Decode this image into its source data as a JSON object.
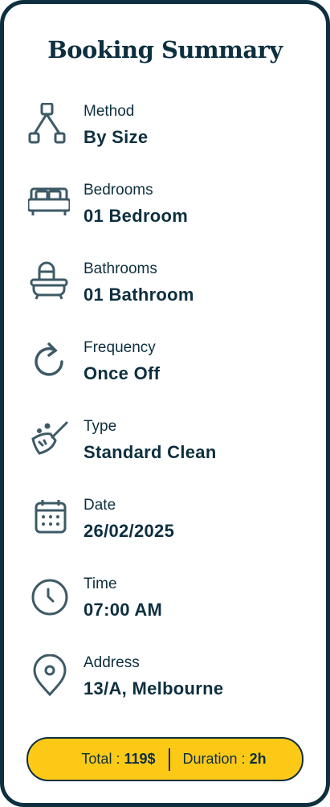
{
  "title": "Booking Summary",
  "items": [
    {
      "icon": "hierarchy-icon",
      "label": "Method",
      "value": "By Size"
    },
    {
      "icon": "bed-icon",
      "label": "Bedrooms",
      "value": "01 Bedroom"
    },
    {
      "icon": "bathtub-icon",
      "label": "Bathrooms",
      "value": "01 Bathroom"
    },
    {
      "icon": "refresh-icon",
      "label": "Frequency",
      "value": "Once Off"
    },
    {
      "icon": "broom-icon",
      "label": "Type",
      "value": "Standard Clean"
    },
    {
      "icon": "calendar-icon",
      "label": "Date",
      "value": "26/02/2025"
    },
    {
      "icon": "clock-icon",
      "label": "Time",
      "value": "07:00 AM"
    },
    {
      "icon": "location-pin-icon",
      "label": "Address",
      "value": "13/A, Melbourne"
    }
  ],
  "summary": {
    "total_label": "Total : ",
    "total_value": "119$",
    "duration_label": "Duration : ",
    "duration_value": "2h"
  },
  "colors": {
    "primary": "#0d2f3f",
    "accent": "#fcc917",
    "icon": "#3d5a66"
  }
}
